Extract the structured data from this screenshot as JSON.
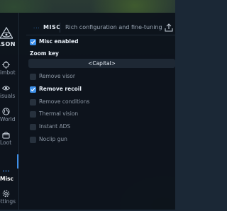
{
  "brand": {
    "name": "ASON",
    "icon": "eye-triangle-icon"
  },
  "sidebar": {
    "items": [
      {
        "label": "imbot",
        "icon": "crosshair-icon"
      },
      {
        "label": "isuals",
        "icon": "eye-icon"
      },
      {
        "label": "World",
        "icon": "globe-icon"
      },
      {
        "label": "Loot",
        "icon": "chest-icon"
      },
      {
        "label": "Misc",
        "icon": "dots-icon",
        "active": true
      },
      {
        "label": "ettings",
        "icon": "gear-icon"
      }
    ]
  },
  "header": {
    "dots": "···",
    "title": "MISC",
    "subtitle": "Rich configuration and fine-tuning",
    "export_icon": "export-icon"
  },
  "options": {
    "misc_enabled": {
      "label": "Misc enabled",
      "checked": true
    },
    "zoom_key": {
      "label": "Zoom key",
      "value": "<Capital>"
    },
    "remove_visor": {
      "label": "Remove visor",
      "checked": false
    },
    "remove_recoil": {
      "label": "Remove recoil",
      "checked": true
    },
    "remove_conditions": {
      "label": "Remove conditions",
      "checked": false
    },
    "thermal_vision": {
      "label": "Thermal vision",
      "checked": false
    },
    "instant_ads": {
      "label": "Instant ADS",
      "checked": false
    },
    "noclip_gun": {
      "label": "Noclip gun",
      "checked": false
    }
  },
  "colors": {
    "accent": "#3d8fe8",
    "panel": "#0d131b",
    "text": "#e6edf5",
    "muted": "#8e99a6"
  }
}
